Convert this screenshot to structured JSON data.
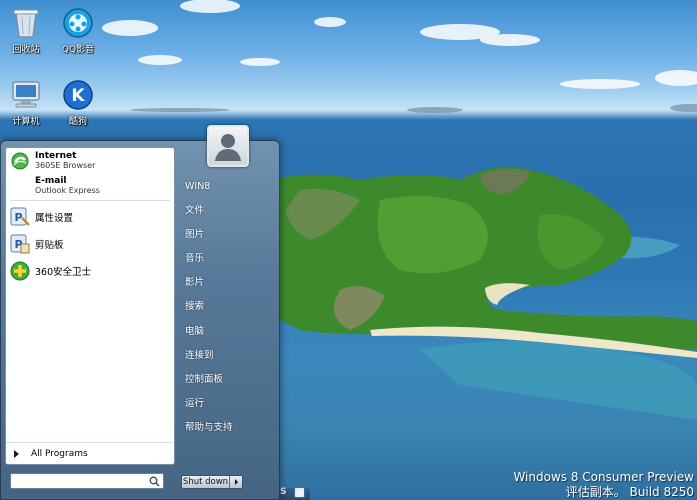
{
  "desktop": {
    "icons": [
      {
        "label": "回收站",
        "icon": "recycle-bin-icon"
      },
      {
        "label": "QQ影音",
        "icon": "qq-player-icon"
      },
      {
        "label": "计算机",
        "icon": "computer-icon"
      },
      {
        "label": "酷狗",
        "icon": "kugou-icon"
      }
    ],
    "watermark": {
      "line1": "Windows 8 Consumer Preview",
      "line2": "评估副本。 Build 8250"
    }
  },
  "start_menu": {
    "pinned": [
      {
        "title": "Internet",
        "subtitle": "360SE Browser",
        "icon": "browser-icon"
      },
      {
        "title": "E-mail",
        "subtitle": "Outlook Express",
        "icon": "email-icon"
      }
    ],
    "programs": [
      {
        "label": "属性设置",
        "icon": "settings-icon"
      },
      {
        "label": "剪贴板",
        "icon": "clipboard-icon"
      },
      {
        "label": "360安全卫士",
        "icon": "security-icon"
      }
    ],
    "all_programs": "All Programs",
    "search": {
      "value": "",
      "placeholder": ""
    },
    "right_items": [
      "WIN8",
      "文件",
      "图片",
      "音乐",
      "影片",
      "搜索",
      "电脑",
      "连接到",
      "控制面板",
      "运行",
      "帮助与支持"
    ],
    "shutdown_label": "Shut down"
  },
  "taskbar": {
    "partial_text": "S"
  },
  "colors": {
    "accent": "#3a88bd",
    "menu_bg": "#5a7896",
    "pane_bg": "#ffffff"
  }
}
